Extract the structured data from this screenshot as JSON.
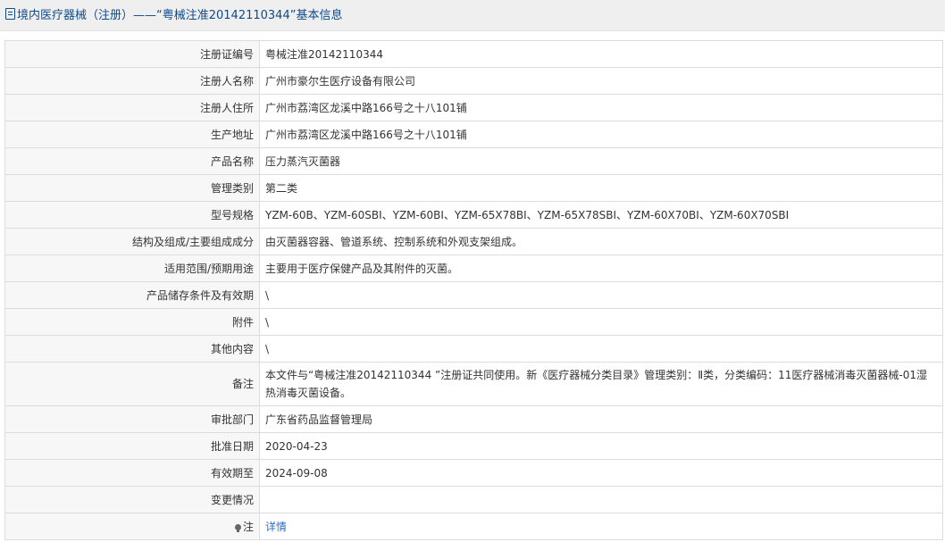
{
  "header": {
    "icon": "document-icon",
    "title": "境内医疗器械（注册）——“粤械注准20142110344”基本信息",
    "color": "#0f4a8a"
  },
  "rows": [
    {
      "label": "注册证编号",
      "value": "粤械注准20142110344"
    },
    {
      "label": "注册人名称",
      "value": "广州市豪尔生医疗设备有限公司"
    },
    {
      "label": "注册人住所",
      "value": "广州市荔湾区龙溪中路166号之十八101铺"
    },
    {
      "label": "生产地址",
      "value": "广州市荔湾区龙溪中路166号之十八101铺"
    },
    {
      "label": "产品名称",
      "value": "压力蒸汽灭菌器"
    },
    {
      "label": "管理类别",
      "value": "第二类"
    },
    {
      "label": "型号规格",
      "value": "YZM-60B、YZM-60SBⅠ、YZM-60BⅠ、YZM-65X78BⅠ、YZM-65X78SBⅠ、YZM-60X70BⅠ、YZM-60X70SBⅠ"
    },
    {
      "label": "结构及组成/主要组成成分",
      "value": "由灭菌器容器、管道系统、控制系统和外观支架组成。"
    },
    {
      "label": "适用范围/预期用途",
      "value": "主要用于医疗保健产品及其附件的灭菌。"
    },
    {
      "label": "产品储存条件及有效期",
      "value": "\\"
    },
    {
      "label": "附件",
      "value": "\\"
    },
    {
      "label": "其他内容",
      "value": "\\"
    },
    {
      "label": "备注",
      "value": "本文件与“粤械注准20142110344 ”注册证共同使用。新《医疗器械分类目录》管理类别：Ⅱ类，分类编码：11医疗器械消毒灭菌器械-01湿热消毒灭菌设备。"
    },
    {
      "label": "审批部门",
      "value": "广东省药品监督管理局"
    },
    {
      "label": "批准日期",
      "value": "2020-04-23"
    },
    {
      "label": "有效期至",
      "value": "2024-09-08"
    },
    {
      "label": "变更情况",
      "value": ""
    }
  ],
  "note": {
    "icon": "lightbulb-icon",
    "label": "注",
    "link_text": "详情",
    "link_color": "#2f6fc2"
  }
}
